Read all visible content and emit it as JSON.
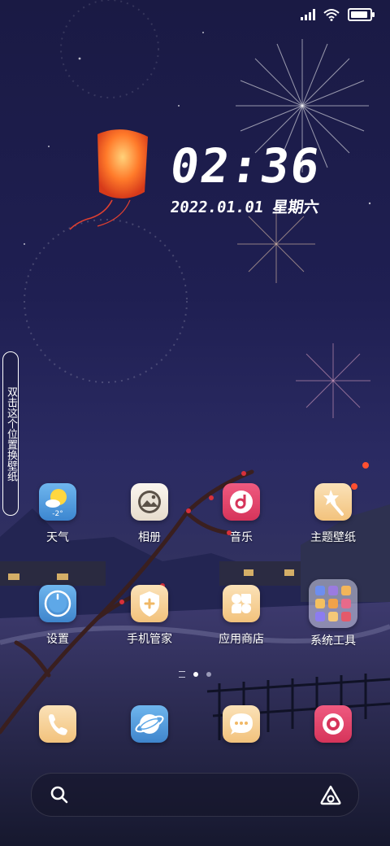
{
  "clock": {
    "time": "02:36",
    "date": "2022.01.01 星期六"
  },
  "side_hint": "双击这个位置换壁纸",
  "page_indicator": {
    "pages": 2,
    "current": 1
  },
  "apps": {
    "weather": {
      "label": "天气",
      "temp": "-2°"
    },
    "gallery": {
      "label": "相册"
    },
    "music": {
      "label": "音乐"
    },
    "themes": {
      "label": "主题壁纸"
    },
    "settings": {
      "label": "设置"
    },
    "security": {
      "label": "手机管家"
    },
    "appstore": {
      "label": "应用商店"
    },
    "systools": {
      "label": "系统工具"
    }
  },
  "dock": [
    "phone-icon",
    "browser-icon",
    "messages-icon",
    "camera-icon"
  ],
  "colors": {
    "background": "#1f1f52",
    "music_icon": "#e0456a",
    "camera_icon": "#e0456a",
    "weather_icon": "#4aa3e0"
  }
}
